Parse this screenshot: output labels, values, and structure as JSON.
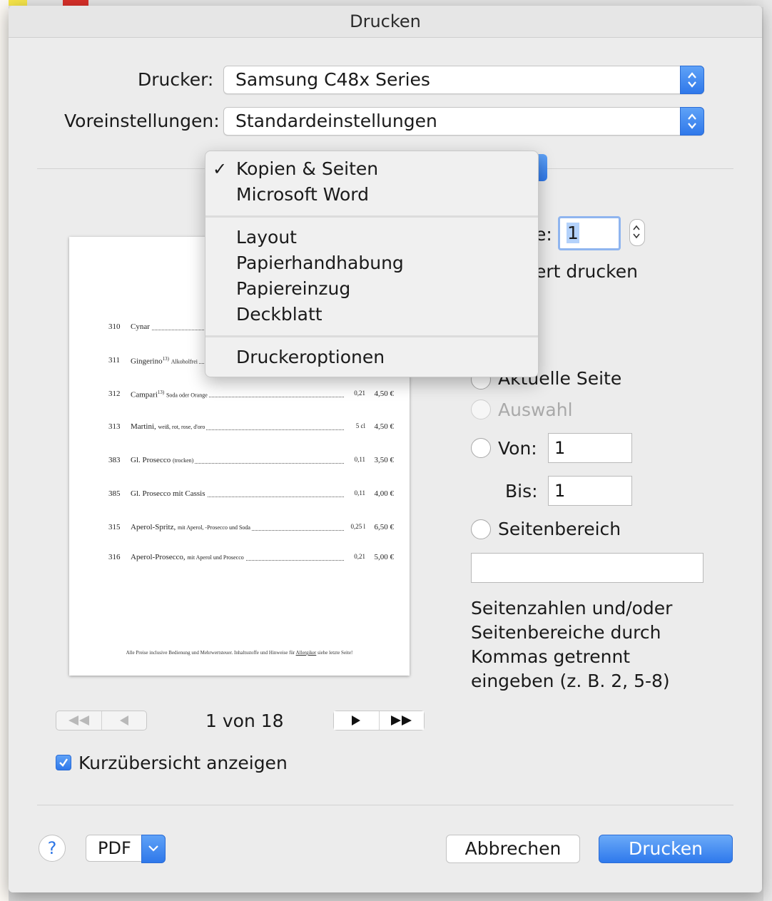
{
  "dialog": {
    "title": "Drucken"
  },
  "printer": {
    "label": "Drucker:",
    "value": "Samsung C48x Series"
  },
  "presets": {
    "label": "Voreinstellungen:",
    "value": "Standardeinstellungen"
  },
  "menu": {
    "selected": "Kopien & Seiten",
    "group1": [
      "Kopien & Seiten",
      "Microsoft Word"
    ],
    "group2": [
      "Layout",
      "Papierhandhabung",
      "Papiereinzug",
      "Deckblatt"
    ],
    "group3": [
      "Druckeroptionen"
    ],
    "checkmark": "✓"
  },
  "copies": {
    "label_fragment": "e:",
    "value": "1"
  },
  "collated": {
    "label_fragment": "ert drucken"
  },
  "pages": {
    "current_page": "Aktuelle Seite",
    "selection": "Auswahl",
    "from_label": "Von:",
    "from_value": "1",
    "to_label": "Bis:",
    "to_value": "1",
    "range_label": "Seitenbereich",
    "range_value": "",
    "hint": "Seitenzahlen und/oder Seitenbereiche durch Kommas getrennt eingeben (z. B. 2, 5-8)"
  },
  "preview": {
    "rows": [
      {
        "num": "310",
        "name": "Cynar",
        "note": "",
        "sup": "",
        "qty": "",
        "price": ""
      },
      {
        "num": "311",
        "name": "Gingerino",
        "sup": "13)",
        "note": "Alkoholfrei",
        "qty": "",
        "price": ""
      },
      {
        "num": "312",
        "name": "Campari",
        "sup": "13)",
        "note": "Soda oder Orange",
        "qty": "0,21",
        "price": "4,50 €"
      },
      {
        "num": "313",
        "name": "Martini,",
        "sup": "",
        "note": "weiß, rot, rose, d'oro",
        "qty": "5 cl",
        "price": "4,50 €"
      },
      {
        "num": "383",
        "name": "Gl. Prosecco",
        "sup": "",
        "note": "(trocken)",
        "qty": "0,11",
        "price": "3,50 €"
      },
      {
        "num": "385",
        "name": "Gl. Prosecco mit Cassis",
        "sup": "",
        "note": "",
        "qty": "0,11",
        "price": "4,00 €"
      },
      {
        "num": "315",
        "name": "Aperol-Spritz,",
        "sup": "",
        "note": "mit Aperol, -Prosecco und Soda",
        "qty": "0,25 l",
        "price": "6,50 €"
      },
      {
        "num": "316",
        "name": "Aperol-Prosecco,",
        "sup": "",
        "note": "mit Aperol und Prosecco",
        "qty": "0,21",
        "price": "5,00 €"
      }
    ],
    "footer_pre": "Alle Preise inclusive Bedienung und Mehrwertsteuer. Inhaltsstoffe und Hinweise für",
    "footer_link": "Allergiker",
    "footer_post": "siehe letzte Seite!"
  },
  "navigation": {
    "page_count": "1 von 18"
  },
  "show_summary": {
    "label": "Kurzübersicht anzeigen",
    "checked": true
  },
  "buttons": {
    "help": "?",
    "pdf": "PDF",
    "cancel": "Abbrechen",
    "print": "Drucken"
  },
  "colors": {
    "accent": "#2f78ea",
    "background": "#ececec"
  }
}
